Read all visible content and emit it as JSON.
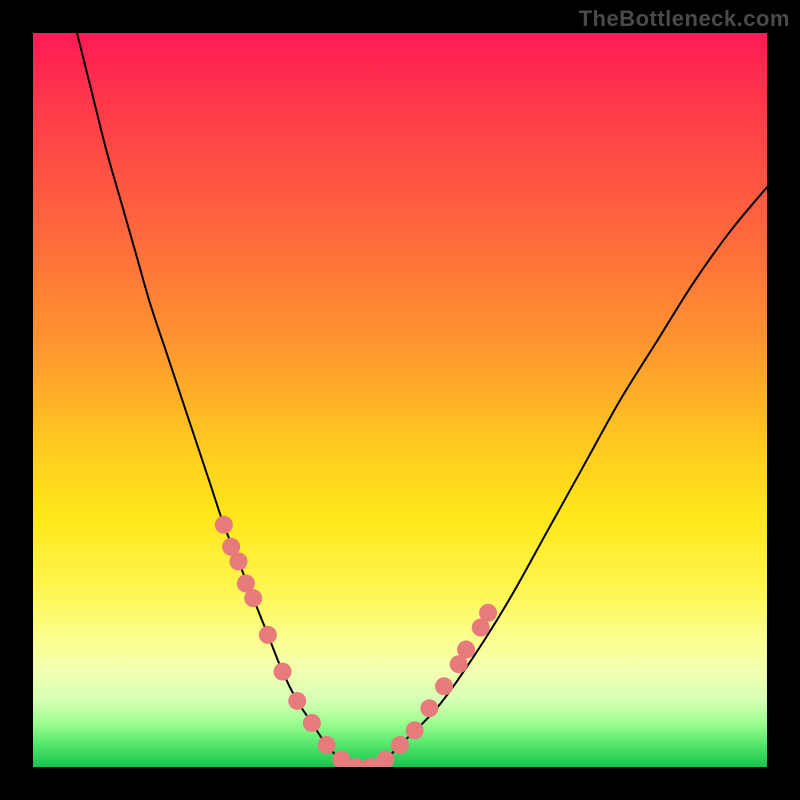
{
  "watermark": "TheBottleneck.com",
  "chart_data": {
    "type": "line",
    "title": "",
    "xlabel": "",
    "ylabel": "",
    "xlim": [
      0,
      100
    ],
    "ylim": [
      0,
      100
    ],
    "gradient_stops": [
      {
        "pos": 0,
        "color": "#ff1a55"
      },
      {
        "pos": 10,
        "color": "#ff3a4a"
      },
      {
        "pos": 28,
        "color": "#ff6a3c"
      },
      {
        "pos": 44,
        "color": "#ff9b2e"
      },
      {
        "pos": 57,
        "color": "#ffcc1f"
      },
      {
        "pos": 66,
        "color": "#ffe81a"
      },
      {
        "pos": 75,
        "color": "#fff44a"
      },
      {
        "pos": 82,
        "color": "#fcff8a"
      },
      {
        "pos": 87,
        "color": "#f2ffb0"
      },
      {
        "pos": 91,
        "color": "#d5ffb4"
      },
      {
        "pos": 94,
        "color": "#9cff8f"
      },
      {
        "pos": 97,
        "color": "#52e66b"
      },
      {
        "pos": 100,
        "color": "#17c24f"
      }
    ],
    "series": [
      {
        "name": "penalty-curve",
        "x": [
          6,
          8,
          10,
          12,
          14,
          16,
          18,
          20,
          22,
          24,
          26,
          28,
          30,
          32,
          34,
          36,
          38,
          40,
          42,
          44,
          46,
          48,
          50,
          55,
          60,
          65,
          70,
          75,
          80,
          85,
          90,
          95,
          100
        ],
        "y": [
          100,
          92,
          84,
          77,
          70,
          63,
          57,
          51,
          45,
          39,
          33,
          28,
          23,
          18,
          13,
          9,
          6,
          3,
          1,
          0,
          0,
          1,
          3,
          8,
          15,
          23,
          32,
          41,
          50,
          58,
          66,
          73,
          79
        ]
      }
    ],
    "optimum_x": 44,
    "markers": {
      "name": "highlight-dots",
      "color": "#e77a7a",
      "points": [
        {
          "x": 26,
          "y": 33
        },
        {
          "x": 27,
          "y": 30
        },
        {
          "x": 28,
          "y": 28
        },
        {
          "x": 29,
          "y": 25
        },
        {
          "x": 30,
          "y": 23
        },
        {
          "x": 32,
          "y": 18
        },
        {
          "x": 34,
          "y": 13
        },
        {
          "x": 36,
          "y": 9
        },
        {
          "x": 38,
          "y": 6
        },
        {
          "x": 40,
          "y": 3
        },
        {
          "x": 42,
          "y": 1
        },
        {
          "x": 44,
          "y": 0
        },
        {
          "x": 46,
          "y": 0
        },
        {
          "x": 48,
          "y": 1
        },
        {
          "x": 50,
          "y": 3
        },
        {
          "x": 52,
          "y": 5
        },
        {
          "x": 54,
          "y": 8
        },
        {
          "x": 56,
          "y": 11
        },
        {
          "x": 58,
          "y": 14
        },
        {
          "x": 59,
          "y": 16
        },
        {
          "x": 61,
          "y": 19
        },
        {
          "x": 62,
          "y": 21
        }
      ]
    }
  }
}
